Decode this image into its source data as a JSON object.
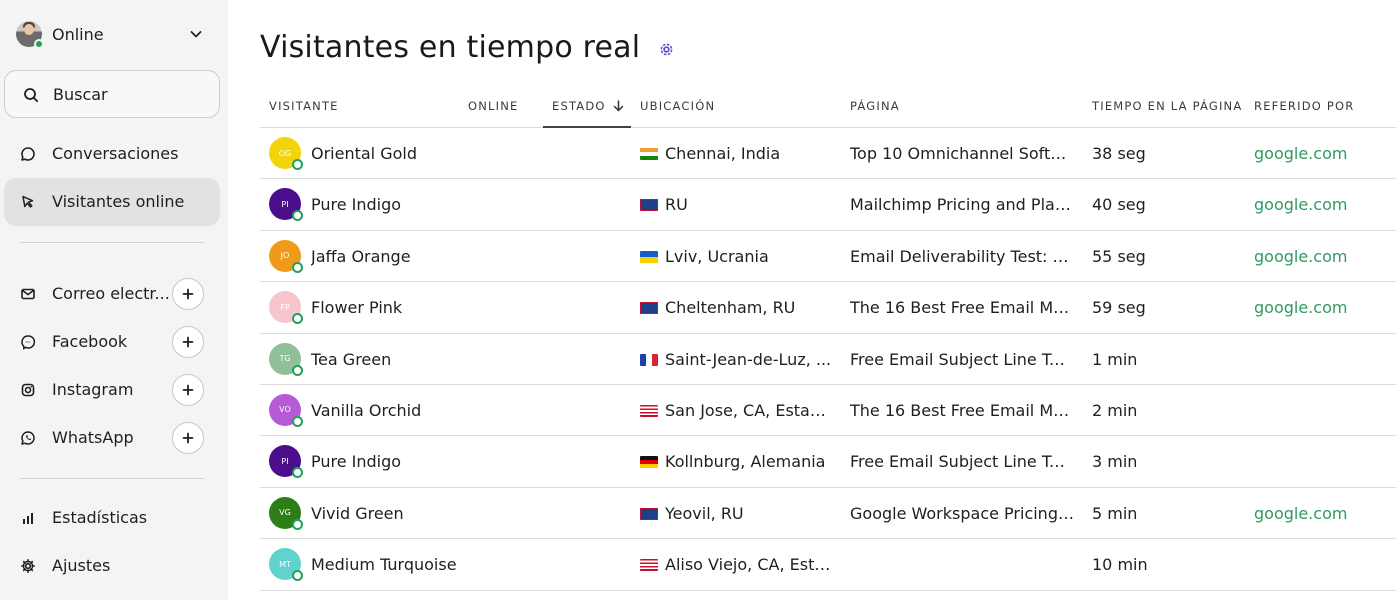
{
  "sidebar": {
    "status": {
      "label": "Online",
      "dot_color": "#22a058"
    },
    "search_label": "Buscar",
    "nav": [
      {
        "label": "Conversaciones",
        "icon": "chat-bubble-icon"
      },
      {
        "label": "Visitantes online",
        "icon": "cursor-arrow-icon",
        "active": true
      }
    ],
    "channels": [
      {
        "label": "Correo electr...",
        "icon": "mail-icon"
      },
      {
        "label": "Facebook",
        "icon": "messenger-icon"
      },
      {
        "label": "Instagram",
        "icon": "instagram-icon"
      },
      {
        "label": "WhatsApp",
        "icon": "whatsapp-icon"
      }
    ],
    "bottom": [
      {
        "label": "Estadísticas",
        "icon": "bar-chart-icon"
      },
      {
        "label": "Ajustes",
        "icon": "gear-icon"
      }
    ]
  },
  "main": {
    "title": "Visitantes en tiempo real",
    "columns": {
      "visitor": "VISITANTE",
      "online": "ONLINE",
      "status": "ESTADO",
      "location": "UBICACIÓN",
      "page": "PÁGINA",
      "time": "TIEMPO EN LA PÁGINA",
      "referrer": "REFERIDO POR"
    },
    "rows": [
      {
        "initials": "OG",
        "name": "Oriental Gold",
        "avatar_color": "#f2d40a",
        "flag": "india",
        "location": "Chennai, India",
        "page": "Top 10 Omnichannel Softw...",
        "time": "38 seg",
        "referrer": "google.com"
      },
      {
        "initials": "PI",
        "name": "Pure Indigo",
        "avatar_color": "#4b0f8c",
        "flag": "uk",
        "location": "RU",
        "page": "Mailchimp Pricing and Plan...",
        "time": "40 seg",
        "referrer": "google.com"
      },
      {
        "initials": "JO",
        "name": "Jaffa Orange",
        "avatar_color": "#f09a1a",
        "flag": "ukraine",
        "location": "Lviv, Ucrania",
        "page": "Email Deliverability Test: Th...",
        "time": "55 seg",
        "referrer": "google.com"
      },
      {
        "initials": "FP",
        "name": "Flower Pink",
        "avatar_color": "#f7c6cc",
        "flag": "uk",
        "location": "Cheltenham, RU",
        "page": "The 16 Best Free Email Mar...",
        "time": "59 seg",
        "referrer": "google.com"
      },
      {
        "initials": "TG",
        "name": "Tea Green",
        "avatar_color": "#8fc09a",
        "flag": "france",
        "location": "Saint-Jean-de-Luz, ...",
        "page": "Free Email Subject Line Tes...",
        "time": "1 min",
        "referrer": ""
      },
      {
        "initials": "VO",
        "name": "Vanilla Orchid",
        "avatar_color": "#b65ad6",
        "flag": "usa",
        "location": "San Jose, CA, Estad...",
        "page": "The 16 Best Free Email Mar...",
        "time": "2 min",
        "referrer": ""
      },
      {
        "initials": "PI",
        "name": "Pure Indigo",
        "avatar_color": "#4b0f8c",
        "flag": "germany",
        "location": "Kollnburg, Alemania",
        "page": "Free Email Subject Line Tes...",
        "time": "3 min",
        "referrer": ""
      },
      {
        "initials": "VG",
        "name": "Vivid Green",
        "avatar_color": "#2e7d18",
        "flag": "uk",
        "location": "Yeovil, RU",
        "page": "Google Workspace Pricing: ...",
        "time": "5 min",
        "referrer": "google.com"
      },
      {
        "initials": "MT",
        "name": "Medium Turquoise",
        "avatar_color": "#5fd3cc",
        "flag": "usa",
        "location": "Aliso Viejo, CA, Esta...",
        "page": "",
        "time": "10 min",
        "referrer": ""
      }
    ]
  }
}
